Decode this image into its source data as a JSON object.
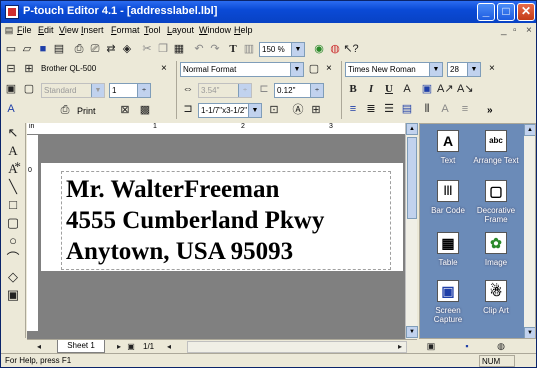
{
  "window": {
    "title": "P-touch Editor 4.1 - [addresslabel.lbl]",
    "controls": {
      "minimize": "_",
      "maximize": "□",
      "close": "✕"
    },
    "mdi_controls": {
      "minimize": "_",
      "restore": "▫",
      "close": "×"
    }
  },
  "menu": {
    "items": [
      "File",
      "Edit",
      "View",
      "Insert",
      "Format",
      "Tool",
      "Layout",
      "Window",
      "Help"
    ]
  },
  "toolbar": {
    "zoom": "150 %",
    "text_icon": "T"
  },
  "printer": {
    "name": "Brother QL-500",
    "close": "×",
    "mode": "Standard",
    "copies": "1",
    "print_label": "Print"
  },
  "format": {
    "format_name": "Normal Format",
    "close": "×",
    "length": "3.54\"",
    "margin": "0.12\"",
    "tape_size": "1-1/7\"x3-1/2\""
  },
  "font": {
    "name": "Times New Roman",
    "size": "28",
    "close": "×",
    "bold": "B",
    "italic": "I",
    "underline": "U",
    "more": "»"
  },
  "ruler": {
    "h_labels": [
      "in",
      "1",
      "2",
      "3"
    ],
    "v_labels": [
      "0"
    ]
  },
  "label": {
    "lines": [
      "Mr. WalterFreeman",
      "4555 Cumberland Pkwy",
      "Anytown, USA    95093"
    ]
  },
  "sheet": {
    "tab": "Sheet 1",
    "page": "1/1"
  },
  "objects_panel": {
    "items": [
      {
        "icon": "A",
        "label": "Text"
      },
      {
        "icon": "abc",
        "label": "Arrange Text"
      },
      {
        "icon": "|||",
        "label": "Bar Code"
      },
      {
        "icon": "▢",
        "label": "Decorative Frame"
      },
      {
        "icon": "▦",
        "label": "Table"
      },
      {
        "icon": "✿",
        "label": "Image"
      },
      {
        "icon": "▣",
        "label": "Screen Capture"
      },
      {
        "icon": "☃",
        "label": "Clip Art"
      }
    ]
  },
  "status": {
    "help": "For Help, press F1",
    "numlock": "NUM"
  },
  "colors": {
    "title_bar": "#0a4ad6",
    "panel_bg": "#6b8bb8",
    "canvas_bg": "#808080"
  }
}
